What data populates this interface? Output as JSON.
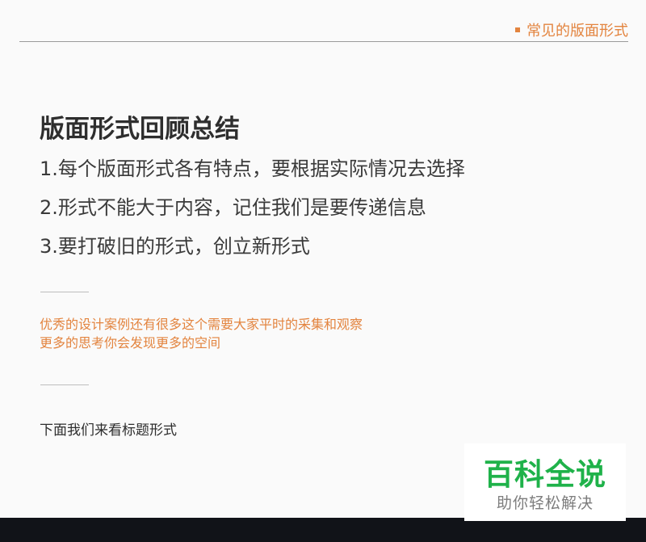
{
  "header": {
    "section_label": "常见的版面形式"
  },
  "main": {
    "title": "版面形式回顾总结",
    "points": [
      "1.每个版面形式各有特点，要根据实际情况去选择",
      "2.形式不能大于内容，记住我们是要传递信息",
      "3.要打破旧的形式，创立新形式"
    ],
    "note_lines": [
      "优秀的设计案例还有很多这个需要大家平时的采集和观察",
      "更多的思考你会发现更多的空间"
    ],
    "next_text": "下面我们来看标题形式"
  },
  "watermark": {
    "main": "百科全说",
    "sub": "助你轻松解决"
  },
  "colors": {
    "accent": "#e3843f",
    "watermark_green": "#1fb24a",
    "footer": "#111318"
  }
}
